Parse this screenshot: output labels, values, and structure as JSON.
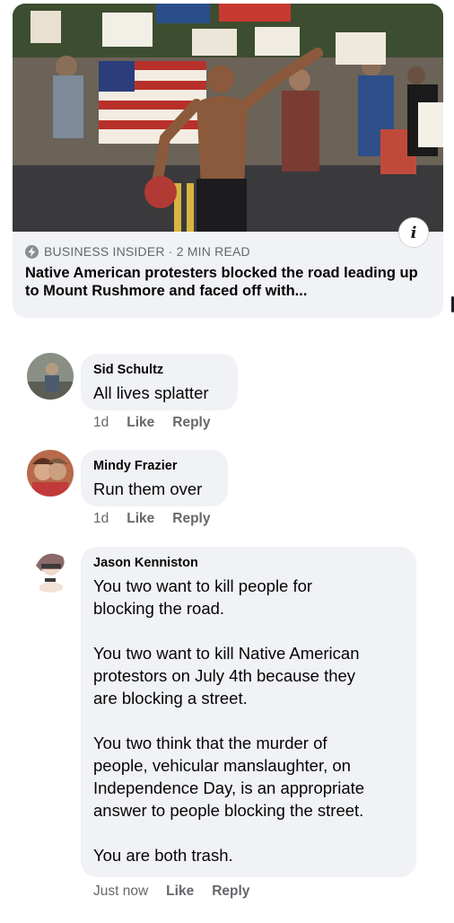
{
  "link_preview": {
    "image_icon": "protest-photo",
    "info_icon_label": "i",
    "source": "BUSINESS INSIDER · 2 MIN READ",
    "headline": "Native American protesters blocked the road leading up to Mount Rushmore and faced off with..."
  },
  "comments": [
    {
      "author": "Sid Schultz",
      "text": "All lives splatter",
      "time": "1d",
      "like": "Like",
      "reply": "Reply"
    },
    {
      "author": "Mindy Frazier",
      "text": "Run them over",
      "time": "1d",
      "like": "Like",
      "reply": "Reply"
    },
    {
      "author": "Jason Kenniston",
      "text": "You two want to kill people for\nblocking the road.\n\nYou two want to kill Native American\nprotestors on July 4th because they\nare blocking a street.\n\nYou two think that the murder of\npeople, vehicular manslaughter, on\nIndependence Day, is an appropriate\nanswer to people blocking the street.\n\nYou are both trash.",
      "time": "Just now",
      "like": "Like",
      "reply": "Reply"
    }
  ],
  "colors": {
    "bubble": "#f0f2f5",
    "meta_text": "#65676b",
    "text": "#050505"
  }
}
